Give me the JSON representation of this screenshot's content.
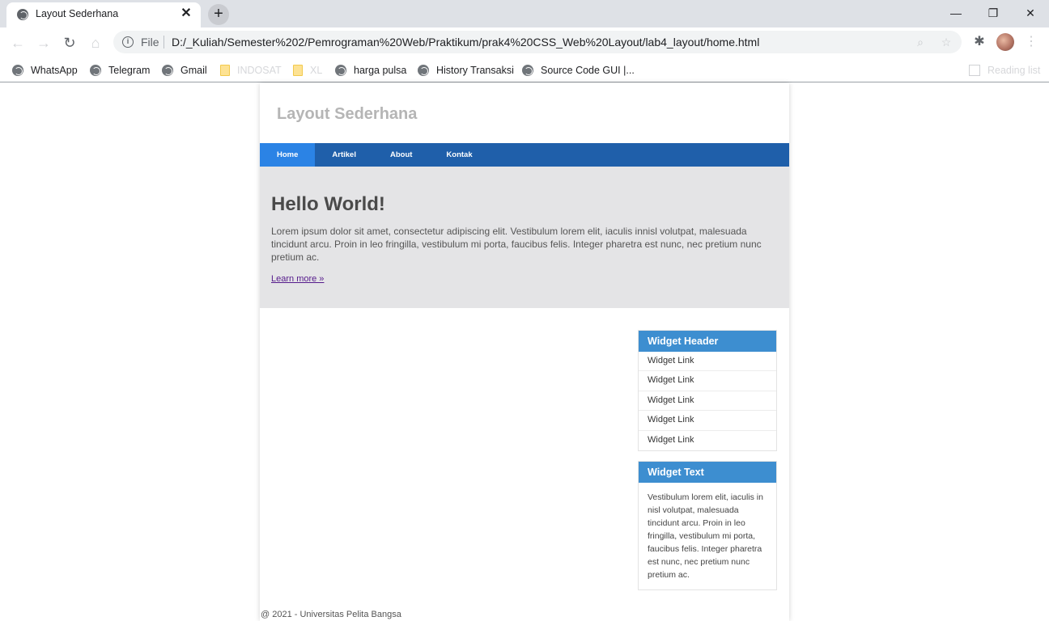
{
  "browser": {
    "tab_title": "Layout Sederhana",
    "tab_close_glyph": "✕",
    "new_tab_glyph": "+",
    "window_controls": {
      "minimize": "—",
      "restore": "❐",
      "close": "✕"
    },
    "nav_glyphs": {
      "back": "←",
      "forward": "→",
      "reload": "↻",
      "home": "⌂"
    },
    "file_label": "File",
    "url": "D:/_Kuliah/Semester%202/Pemrograman%20Web/Praktikum/prak4%20CSS_Web%20Layout/lab4_layout/home.html",
    "bookmarks": [
      {
        "label": "WhatsApp",
        "icon": "globe-icon"
      },
      {
        "label": "Telegram",
        "icon": "globe-icon"
      },
      {
        "label": "Gmail",
        "icon": "globe-icon"
      },
      {
        "label": "INDOSAT",
        "icon": "folder-icon"
      },
      {
        "label": "XL",
        "icon": "folder-icon"
      },
      {
        "label": "harga pulsa",
        "icon": "globe-icon"
      },
      {
        "label": "History Transaksi",
        "icon": "globe-icon"
      },
      {
        "label": "Source Code GUI |...",
        "icon": "globe-icon"
      }
    ],
    "reading_list": "Reading list"
  },
  "site": {
    "title": "Layout Sederhana",
    "nav": [
      {
        "label": "Home",
        "active": true
      },
      {
        "label": "Artikel",
        "active": false
      },
      {
        "label": "About",
        "active": false
      },
      {
        "label": "Kontak",
        "active": false
      }
    ],
    "hero": {
      "title": "Hello World!",
      "text": "Lorem ipsum dolor sit amet, consectetur adipiscing elit. Vestibulum lorem elit, iaculis innisl volutpat, malesuada tincidunt arcu. Proin in leo fringilla, vestibulum mi porta, faucibus felis. Integer pharetra est nunc, nec pretium nunc pretium ac.",
      "link": "Learn more »"
    },
    "widget_links": {
      "header": "Widget Header",
      "links": [
        "Widget Link",
        "Widget Link",
        "Widget Link",
        "Widget Link",
        "Widget Link"
      ]
    },
    "widget_text": {
      "header": "Widget Text",
      "body": "Vestibulum lorem elit, iaculis in nisl volutpat, malesuada tincidunt arcu. Proin in leo fringilla, vestibulum mi porta, faucibus felis. Integer pharetra est nunc, nec pretium nunc pretium ac."
    },
    "footer": "@ 2021 - Universitas Pelita Bangsa"
  },
  "colors": {
    "nav_bg": "#1f5faa",
    "nav_active": "#2b83e5",
    "hero_bg": "#e4e4e6",
    "widget_header": "#3d8ed0"
  }
}
